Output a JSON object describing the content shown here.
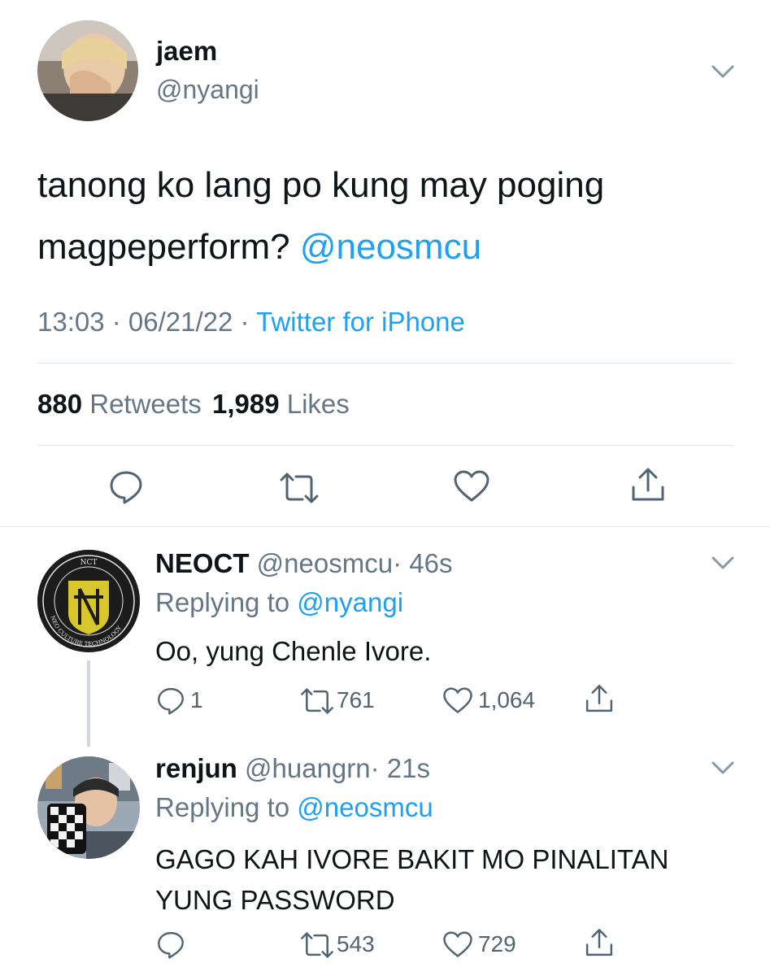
{
  "main_tweet": {
    "name": "jaem",
    "handle": "@nyangi",
    "text": "tanong ko lang po kung may poging magpeperform?",
    "mention": "@neosmcu",
    "time": "13:03 · 06/21/22 ·",
    "source": "Twitter for iPhone",
    "retweets_count": "880",
    "retweets_label": "Retweets",
    "likes_count": "1,989",
    "likes_label": "Likes"
  },
  "replies": [
    {
      "name": "NEOCT",
      "handle": "@neosmcu",
      "age": "· 46s",
      "replying_label": "Replying to",
      "replying_to": "@nyangi",
      "text": "Oo, yung Chenle Ivore.",
      "reply_count": "1",
      "retweet_count": "761",
      "like_count": "1,064",
      "avatar_logo_top": "NCT",
      "avatar_logo_ring": "NEO CULTURE TECHNOLOGY"
    },
    {
      "name": "renjun",
      "handle": "@huangrn",
      "age": "· 21s",
      "replying_label": "Replying to",
      "replying_to": "@neosmcu",
      "text_line1": "GAGO KAH IVORE BAKIT MO PINALITAN",
      "text_line2": "YUNG PASSWORD",
      "retweet_count": "543",
      "like_count": "729"
    }
  ],
  "colors": {
    "link": "#1da1f2",
    "muted": "#657786",
    "divider": "#e1e8ed",
    "icon": "#536471"
  }
}
